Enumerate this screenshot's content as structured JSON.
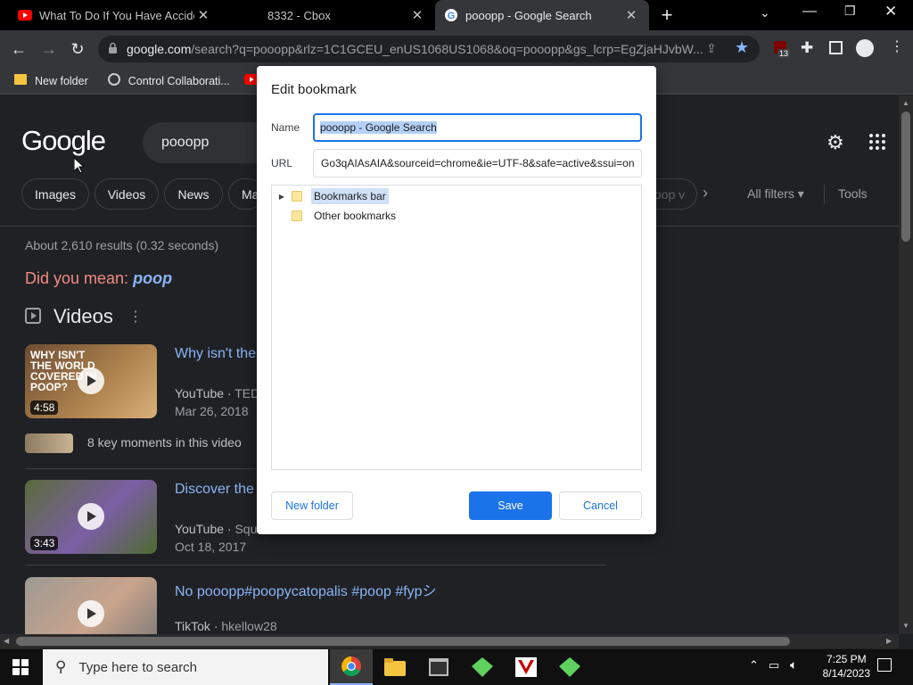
{
  "tabs": [
    {
      "title": "What To Do If You Have Accident",
      "favicon": "youtube-icon"
    },
    {
      "title": "8332 - Cbox",
      "favicon": "blank-icon"
    },
    {
      "title": "pooopp - Google Search",
      "favicon": "google-icon"
    }
  ],
  "address": {
    "host": "google.com",
    "path": "/search?q=pooopp&rlz=1C1GCEU_enUS1068US1068&oq=pooopp&gs_lcrp=EgZjaHJvbW..."
  },
  "extension_badge": "13",
  "bookmarks_bar": [
    {
      "label": "New folder",
      "icon": "folder-icon"
    },
    {
      "label": "Control Collaborati...",
      "icon": "control-icon"
    },
    {
      "label": "",
      "icon": "youtube-icon"
    }
  ],
  "google": {
    "logo": "Google",
    "query": "pooopp",
    "chips": [
      "Images",
      "Videos",
      "News",
      "Ma"
    ],
    "chip_partial": "oop v",
    "all_filters": "All filters",
    "tools": "Tools",
    "stats": "About 2,610 results (0.32 seconds)",
    "did_you_mean_label": "Did you mean:",
    "did_you_mean_term": "poop",
    "videos_heading": "Videos",
    "videos": [
      {
        "title": "Why isn't the",
        "source": "YouTube",
        "channel": "TED",
        "date": "Mar 26, 2018",
        "duration": "4:58",
        "thumb_text": "WHY ISN'T THE WORLD COVERED IN POOP?"
      },
      {
        "title": "Discover the",
        "source": "YouTube",
        "channel": "Squ",
        "date": "Oct 18, 2017",
        "duration": "3:43",
        "thumb_text": ""
      },
      {
        "title": "No pooopp#poopycatopalis #poop #fypシ",
        "source": "TikTok",
        "channel": "hkellow28",
        "date": "",
        "duration": "",
        "thumb_text": ""
      }
    ],
    "key_moments": "8 key moments in this video"
  },
  "dialog": {
    "title": "Edit bookmark",
    "name_label": "Name",
    "name_value": "pooopp - Google Search",
    "url_label": "URL",
    "url_value": "Go3qAIAsAIA&sourceid=chrome&ie=UTF-8&safe=active&ssui=on",
    "folders": [
      "Bookmarks bar",
      "Other bookmarks"
    ],
    "selected_folder": "Bookmarks bar",
    "new_folder_label": "New folder",
    "save_label": "Save",
    "cancel_label": "Cancel"
  },
  "taskbar": {
    "search_placeholder": "Type here to search",
    "apps": [
      "chrome-icon",
      "file-explorer-icon",
      "app-window-icon",
      "green-app-icon",
      "checkers-app-icon",
      "green-app-icon-2"
    ],
    "time": "7:25 PM",
    "date": "8/14/2023"
  },
  "colors": {
    "accent": "#1a73e8",
    "link": "#8ab4f8",
    "did_you_mean": "#f28b82"
  }
}
